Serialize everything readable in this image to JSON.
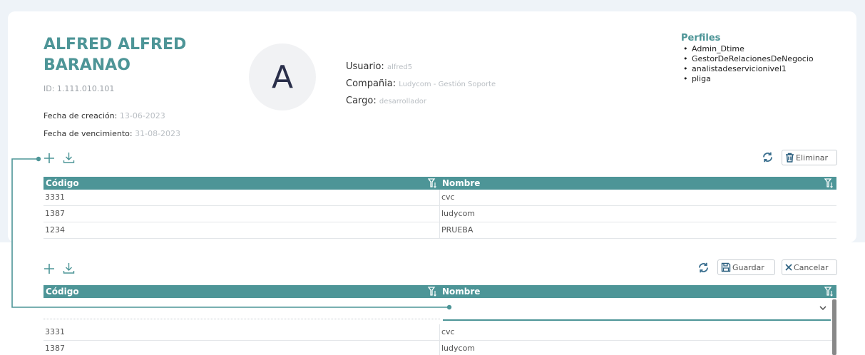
{
  "user": {
    "name": "ALFRED ALFRED BARANAO",
    "id": "ID: 1.111.010.101",
    "avatar_letter": "A",
    "fecha_creacion_label": "Fecha de creación:",
    "fecha_creacion": "13-06-2023",
    "fecha_vencimiento_label": "Fecha de vencimiento:",
    "fecha_vencimiento": "31-08-2023",
    "usuario_label": "Usuario:",
    "usuario": "alfred5",
    "compania_label": "Compañia:",
    "compania": "Ludycom - Gestión Soporte",
    "cargo_label": "Cargo:",
    "cargo": "desarrollador"
  },
  "profiles": {
    "title": "Perfiles",
    "items": [
      "Admin_Dtime",
      "GestorDeRelacionesDeNegocio",
      "analistadeservicionivel1",
      "pliga"
    ]
  },
  "grid1": {
    "delete_label": "Eliminar",
    "columns": [
      "Código",
      "Nombre"
    ],
    "rows": [
      [
        "3331",
        "cvc"
      ],
      [
        "1387",
        "ludycom"
      ],
      [
        "1234",
        "PRUEBA"
      ]
    ]
  },
  "grid2": {
    "save_label": "Guardar",
    "cancel_label": "Cancelar",
    "columns": [
      "Código",
      "Nombre"
    ],
    "rows": [
      [
        "3331",
        "cvc"
      ],
      [
        "1387",
        "ludycom"
      ]
    ]
  },
  "colors": {
    "accent": "#4d9597",
    "background": "#eef3f8"
  },
  "icons": [
    "plus-icon",
    "download-icon",
    "refresh-icon",
    "trash-icon",
    "save-icon",
    "close-icon",
    "filter-icon",
    "chevron-down-icon"
  ]
}
